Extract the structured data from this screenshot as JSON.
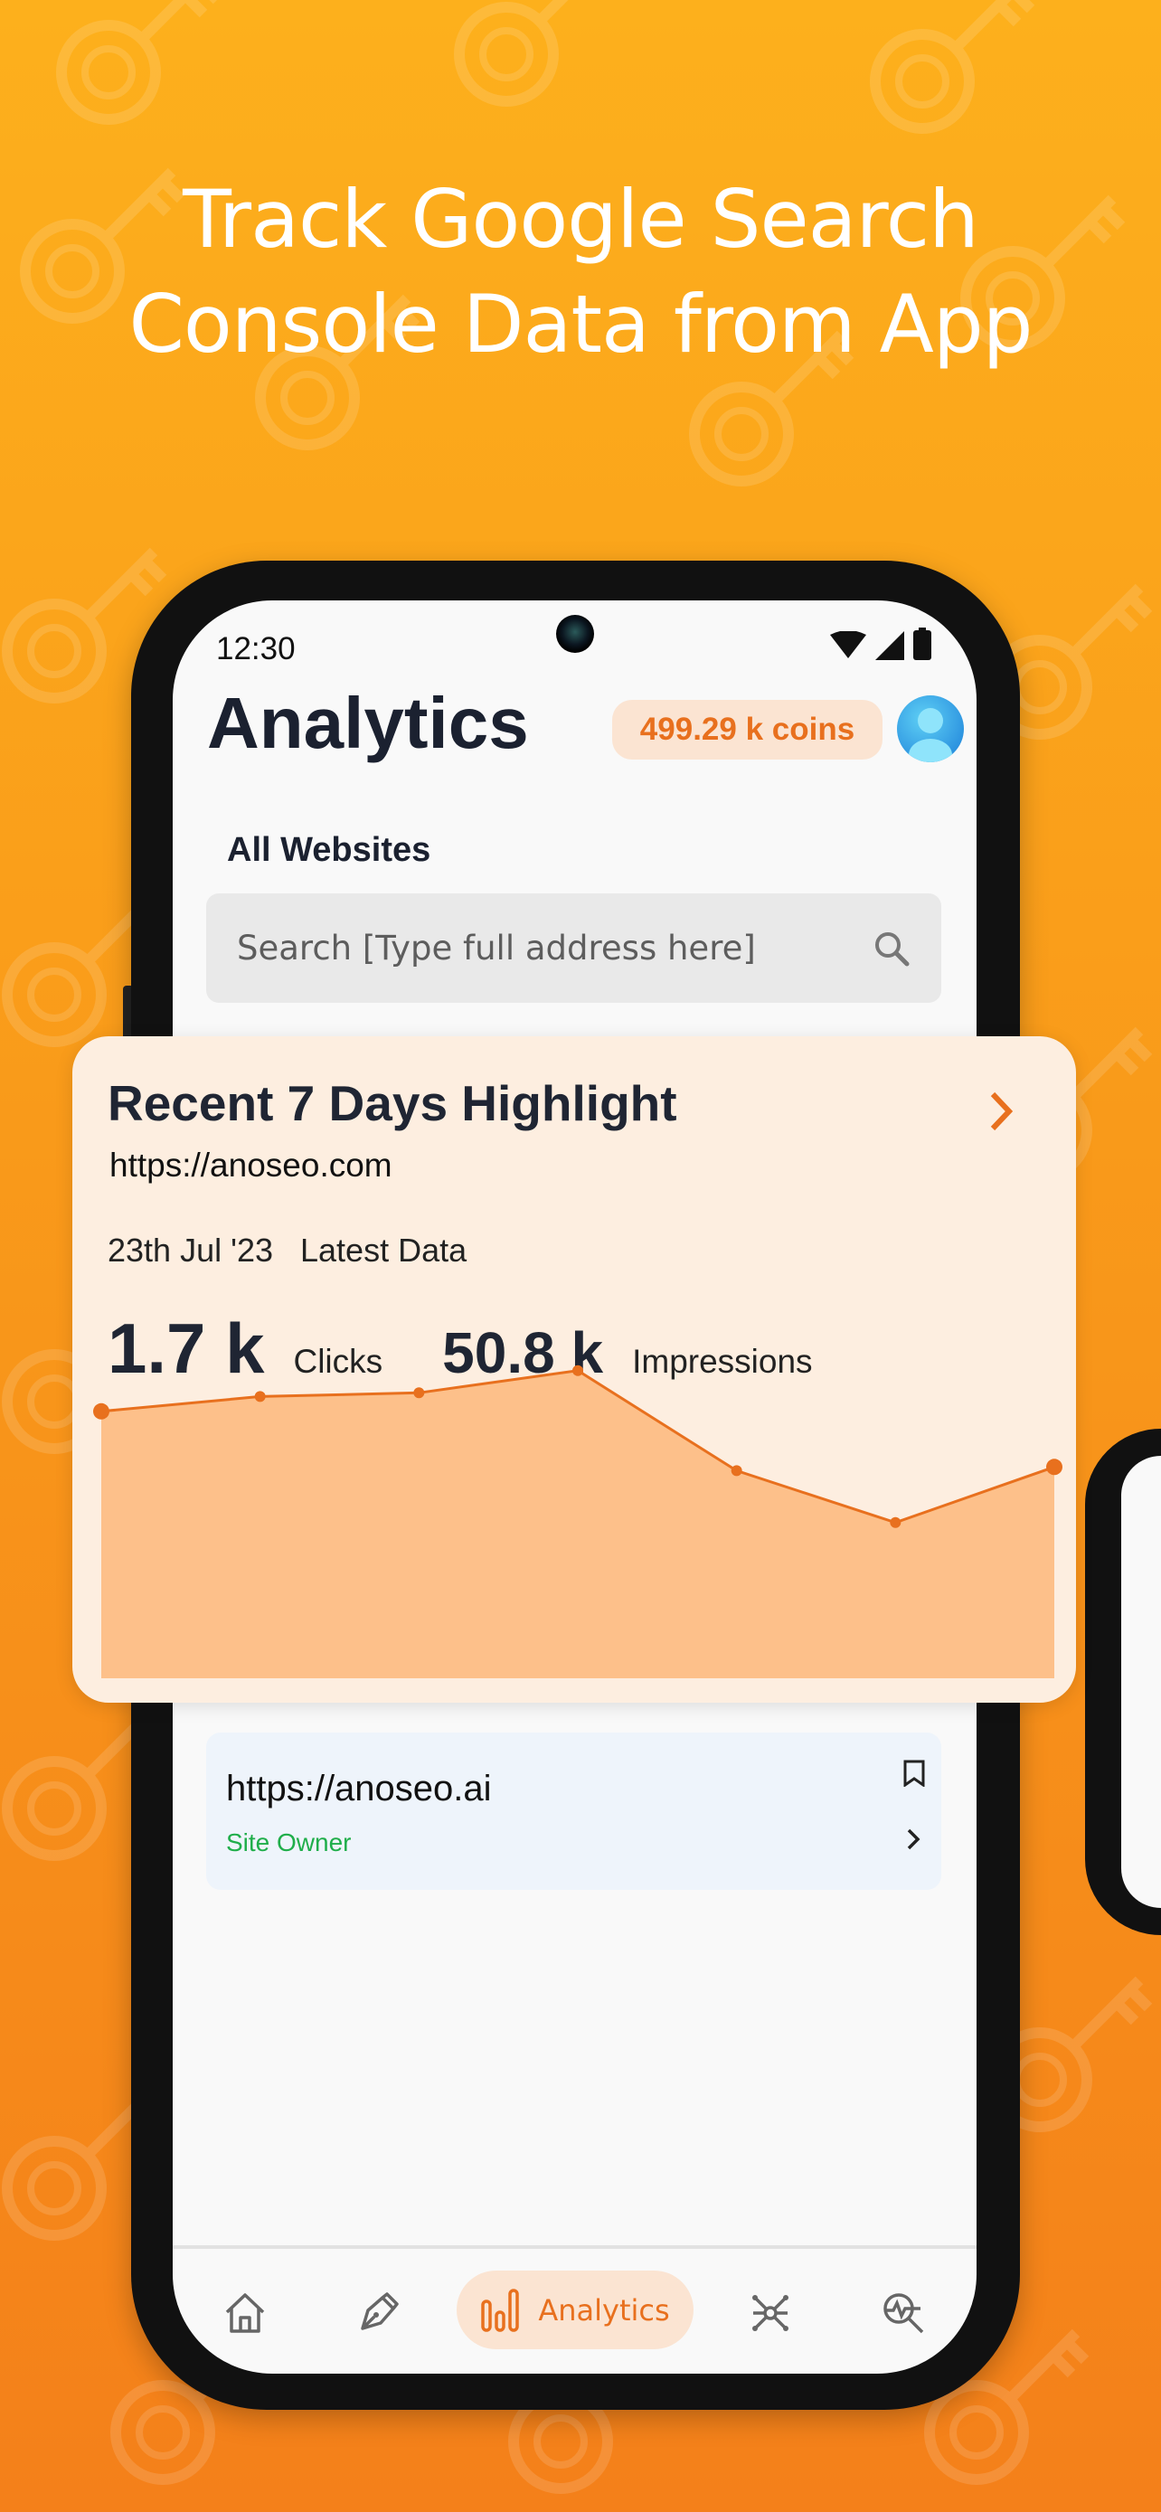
{
  "headline": {
    "line1": "Track Google Search",
    "line2": "Console Data from App"
  },
  "status_bar": {
    "time": "12:30",
    "icons": [
      "wifi-icon",
      "signal-icon",
      "battery-icon"
    ]
  },
  "header": {
    "title": "Analytics",
    "coins": "499.29 k coins",
    "avatar": "user-avatar-icon"
  },
  "section": {
    "title": "All Websites"
  },
  "search": {
    "placeholder": "Search [Type full address here]",
    "value": "",
    "icon": "search-icon"
  },
  "highlight_card": {
    "title": "Recent 7 Days Highlight",
    "url": "https://anoseo.com",
    "date": "23th Jul '23",
    "date_label": "Latest Data",
    "clicks_value": "1.7 k",
    "clicks_label": "Clicks",
    "impressions_value": "50.8 k",
    "impressions_label": "Impressions"
  },
  "chart_data": {
    "type": "area",
    "values": [
      72,
      76,
      77,
      83,
      56,
      42,
      57
    ],
    "ylim": [
      0,
      100
    ],
    "grid": false,
    "color": "#e8701e",
    "fill": "#fdc08a"
  },
  "sites": [
    {
      "url": "https://anoseo.ai",
      "role": "Site Owner"
    }
  ],
  "bottom_nav": {
    "items": [
      {
        "icon": "home-icon"
      },
      {
        "icon": "pen-icon"
      },
      {
        "icon": "analytics-icon",
        "label": "Analytics",
        "active": true
      },
      {
        "icon": "network-icon"
      },
      {
        "icon": "seo-search-icon"
      }
    ]
  },
  "colors": {
    "accent": "#e8701e",
    "accent_bg": "#fbe4d2",
    "card_bg": "#fdeee0",
    "owner_green": "#1fae4a"
  }
}
